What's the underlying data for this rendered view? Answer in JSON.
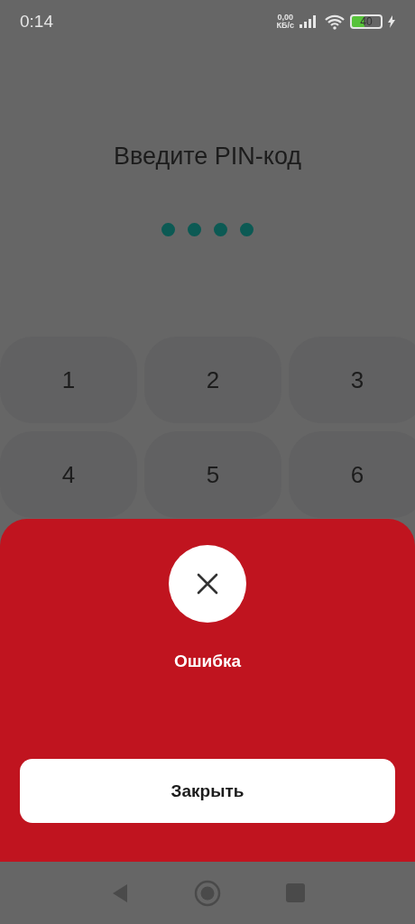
{
  "status_bar": {
    "time": "0:14",
    "speed_value": "0,00",
    "speed_unit": "КБ/с",
    "battery": "40"
  },
  "title": "Введите PIN-код",
  "pin_dots": [
    {
      "filled": true
    },
    {
      "filled": true
    },
    {
      "filled": true
    },
    {
      "filled": true
    }
  ],
  "keypad": [
    "1",
    "2",
    "3",
    "4",
    "5",
    "6"
  ],
  "error_sheet": {
    "message": "Ошибка",
    "button": "Закрыть"
  }
}
